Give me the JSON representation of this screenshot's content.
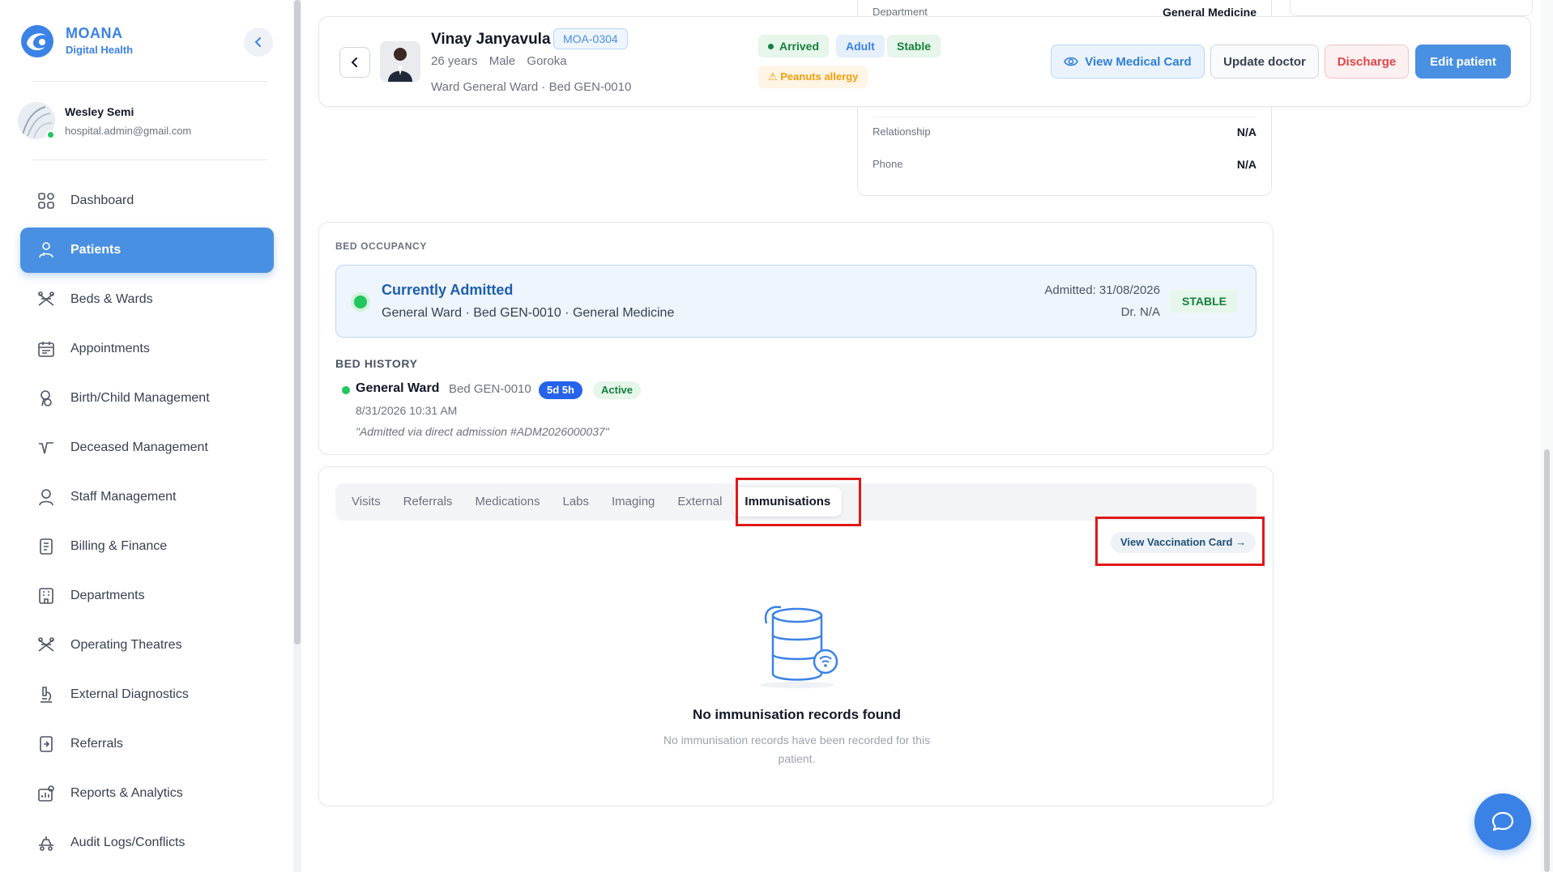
{
  "brand": {
    "name": "MOANA",
    "subtitle": "Digital Health"
  },
  "user": {
    "name": "Wesley Semi",
    "email": "hospital.admin@gmail.com",
    "status": "online"
  },
  "sidebar": {
    "items": [
      {
        "label": "Dashboard",
        "icon": "dashboard-icon",
        "active": false
      },
      {
        "label": "Patients",
        "icon": "patients-icon",
        "active": true
      },
      {
        "label": "Beds & Wards",
        "icon": "bed-icon",
        "active": false
      },
      {
        "label": "Appointments",
        "icon": "calendar-icon",
        "active": false
      },
      {
        "label": "Birth/Child Management",
        "icon": "baby-icon",
        "active": false
      },
      {
        "label": "Deceased Management",
        "icon": "deceased-icon",
        "active": false
      },
      {
        "label": "Staff Management",
        "icon": "staff-icon",
        "active": false
      },
      {
        "label": "Billing & Finance",
        "icon": "billing-icon",
        "active": false
      },
      {
        "label": "Departments",
        "icon": "departments-icon",
        "active": false
      },
      {
        "label": "Operating Theatres",
        "icon": "theatre-icon",
        "active": false
      },
      {
        "label": "External Diagnostics",
        "icon": "microscope-icon",
        "active": false
      },
      {
        "label": "Referrals",
        "icon": "referral-icon",
        "active": false
      },
      {
        "label": "Reports & Analytics",
        "icon": "reports-icon",
        "active": false
      },
      {
        "label": "Audit Logs/Conflicts",
        "icon": "audit-icon",
        "active": false
      }
    ]
  },
  "contact": {
    "department_label": "Department",
    "department_value": "General Medicine",
    "relationship_label": "Relationship",
    "relationship_value": "N/A",
    "phone_label": "Phone",
    "phone_value": "N/A"
  },
  "patient": {
    "name": "Vinay Janyavula",
    "mrn": "MOA-0304",
    "age": "26 years",
    "sex": "Male",
    "location": "Goroka",
    "ward_line": "Ward General Ward · Bed GEN-0010",
    "badges": {
      "arrived": "Arrived",
      "age_group": "Adult",
      "condition": "Stable",
      "allergy": "⚠ Peanuts allergy"
    }
  },
  "actions": {
    "view_card": "View Medical Card",
    "update_doctor": "Update doctor",
    "discharge": "Discharge",
    "edit": "Edit patient"
  },
  "bed_occupancy": {
    "section_label": "BED OCCUPANCY",
    "status_title": "Currently Admitted",
    "status_detail": "General Ward · Bed GEN-0010 · General Medicine",
    "admitted": "Admitted: 31/08/2026",
    "doctor": "Dr. N/A",
    "badge": "STABLE"
  },
  "bed_history": {
    "section_label": "BED HISTORY",
    "entries": [
      {
        "ward": "General Ward",
        "bed": "Bed GEN-0010",
        "duration": "5d 5h",
        "status": "Active",
        "datetime": "8/31/2026 10:31 AM",
        "note": "\"Admitted via direct admission #ADM2026000037\""
      }
    ]
  },
  "tabs": {
    "items": [
      "Visits",
      "Referrals",
      "Medications",
      "Labs",
      "Imaging",
      "External",
      "Immunisations"
    ],
    "active": "Immunisations"
  },
  "immunisations": {
    "vaccination_card_button": "View Vaccination Card →",
    "empty_title": "No immunisation records found",
    "empty_desc": "No immunisation records have been recorded for this patient."
  },
  "colors": {
    "accent": "#4a90e2",
    "success": "#15803d",
    "danger": "#e0464a",
    "warning": "#f59e0b",
    "highlight": "#e01818"
  }
}
